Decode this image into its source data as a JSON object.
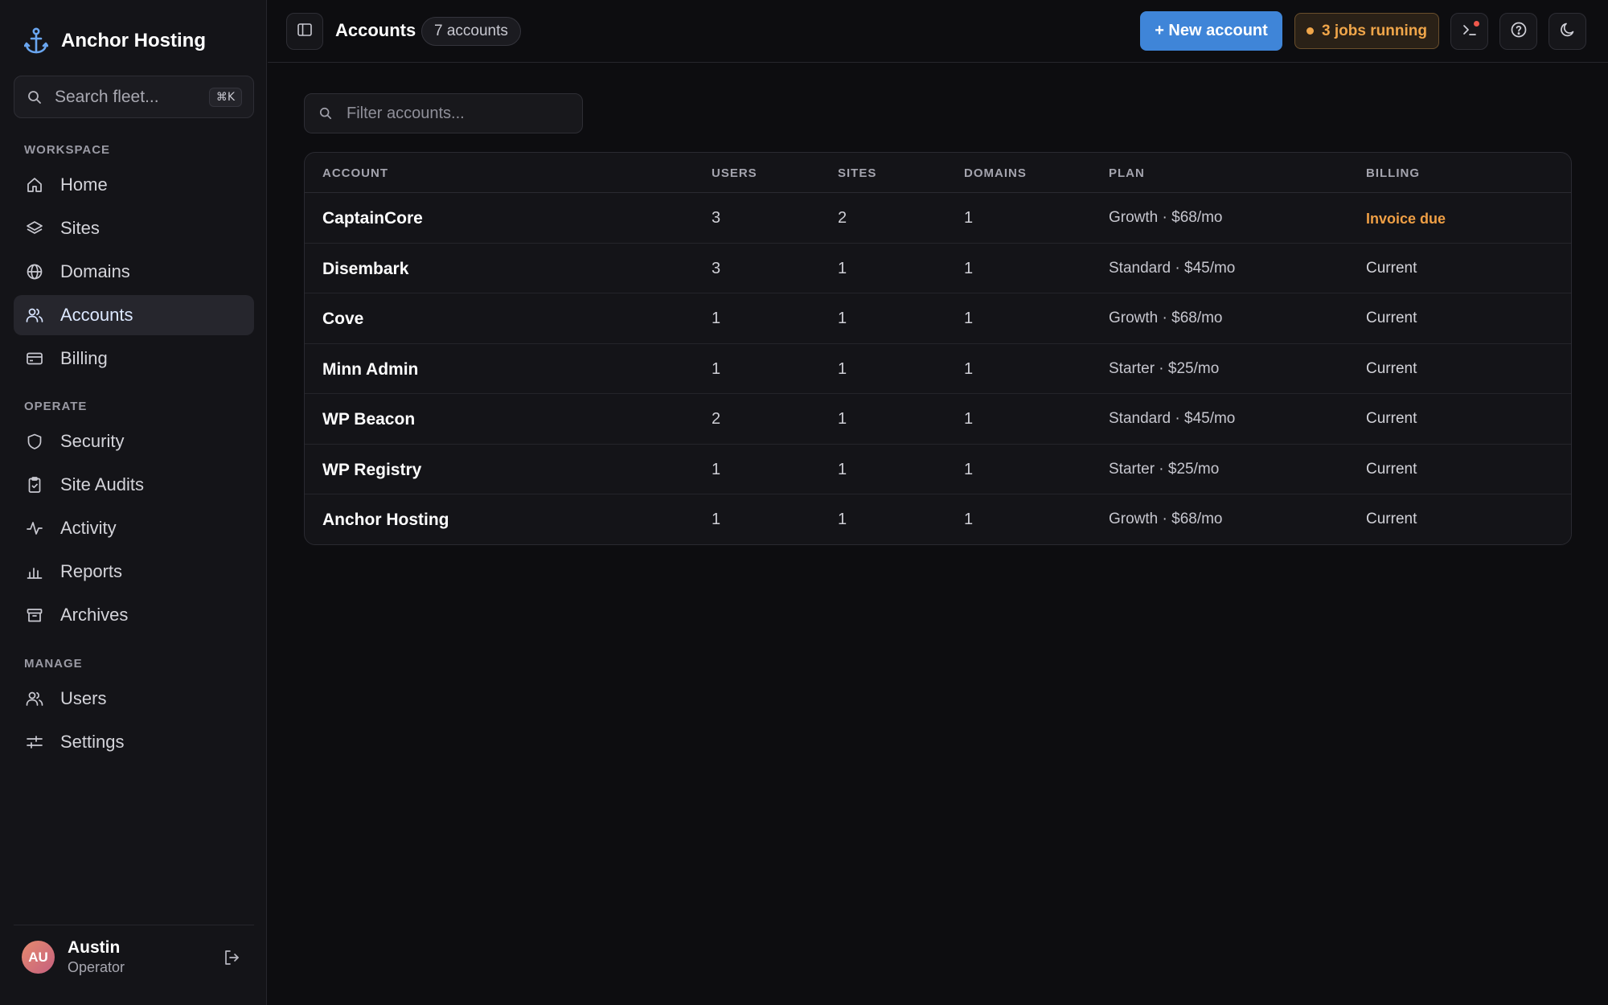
{
  "sidebar": {
    "brand": "Anchor Hosting",
    "search": {
      "placeholder": "Search fleet...",
      "shortcut": "⌘K"
    },
    "sections": [
      {
        "label": "WORKSPACE",
        "items": [
          "Home",
          "Sites",
          "Domains",
          "Accounts",
          "Billing"
        ]
      },
      {
        "label": "OPERATE",
        "items": [
          "Security",
          "Site Audits",
          "Activity",
          "Reports",
          "Archives"
        ]
      },
      {
        "label": "MANAGE",
        "items": [
          "Users",
          "Settings"
        ]
      }
    ],
    "active_item": "Accounts",
    "user": {
      "initials": "AU",
      "name": "Austin",
      "role": "Operator"
    }
  },
  "header": {
    "title": "Accounts",
    "count_badge": "7 accounts",
    "new_button": "+ New account",
    "jobs_label": "3 jobs running"
  },
  "filter": {
    "placeholder": "Filter accounts..."
  },
  "table": {
    "columns": [
      "ACCOUNT",
      "USERS",
      "SITES",
      "DOMAINS",
      "PLAN",
      "BILLING"
    ],
    "rows": [
      {
        "account": "CaptainCore",
        "users": "3",
        "sites": "2",
        "domains": "1",
        "plan": "Growth · $68/mo",
        "billing": "Invoice due"
      },
      {
        "account": "Disembark",
        "users": "3",
        "sites": "1",
        "domains": "1",
        "plan": "Standard · $45/mo",
        "billing": "Current"
      },
      {
        "account": "Cove",
        "users": "1",
        "sites": "1",
        "domains": "1",
        "plan": "Growth · $68/mo",
        "billing": "Current"
      },
      {
        "account": "Minn Admin",
        "users": "1",
        "sites": "1",
        "domains": "1",
        "plan": "Starter · $25/mo",
        "billing": "Current"
      },
      {
        "account": "WP Beacon",
        "users": "2",
        "sites": "1",
        "domains": "1",
        "plan": "Standard · $45/mo",
        "billing": "Current"
      },
      {
        "account": "WP Registry",
        "users": "1",
        "sites": "1",
        "domains": "1",
        "plan": "Starter · $25/mo",
        "billing": "Current"
      },
      {
        "account": "Anchor Hosting",
        "users": "1",
        "sites": "1",
        "domains": "1",
        "plan": "Growth · $68/mo",
        "billing": "Current"
      }
    ]
  },
  "colors": {
    "accent": "#3f85d8",
    "warning": "#ef9f45",
    "background": "#0d0d10",
    "sidebar": "#141418"
  },
  "icons": {
    "brand": "anchor-icon",
    "nav": [
      "home-icon",
      "layers-icon",
      "globe-icon",
      "users-icon",
      "credit-card-icon",
      "shield-icon",
      "clipboard-check-icon",
      "activity-icon",
      "bar-chart-icon",
      "archive-icon",
      "users-icon",
      "sliders-icon"
    ],
    "topbar": [
      "sidebar-toggle-icon",
      "terminal-icon",
      "help-icon",
      "moon-icon"
    ]
  }
}
